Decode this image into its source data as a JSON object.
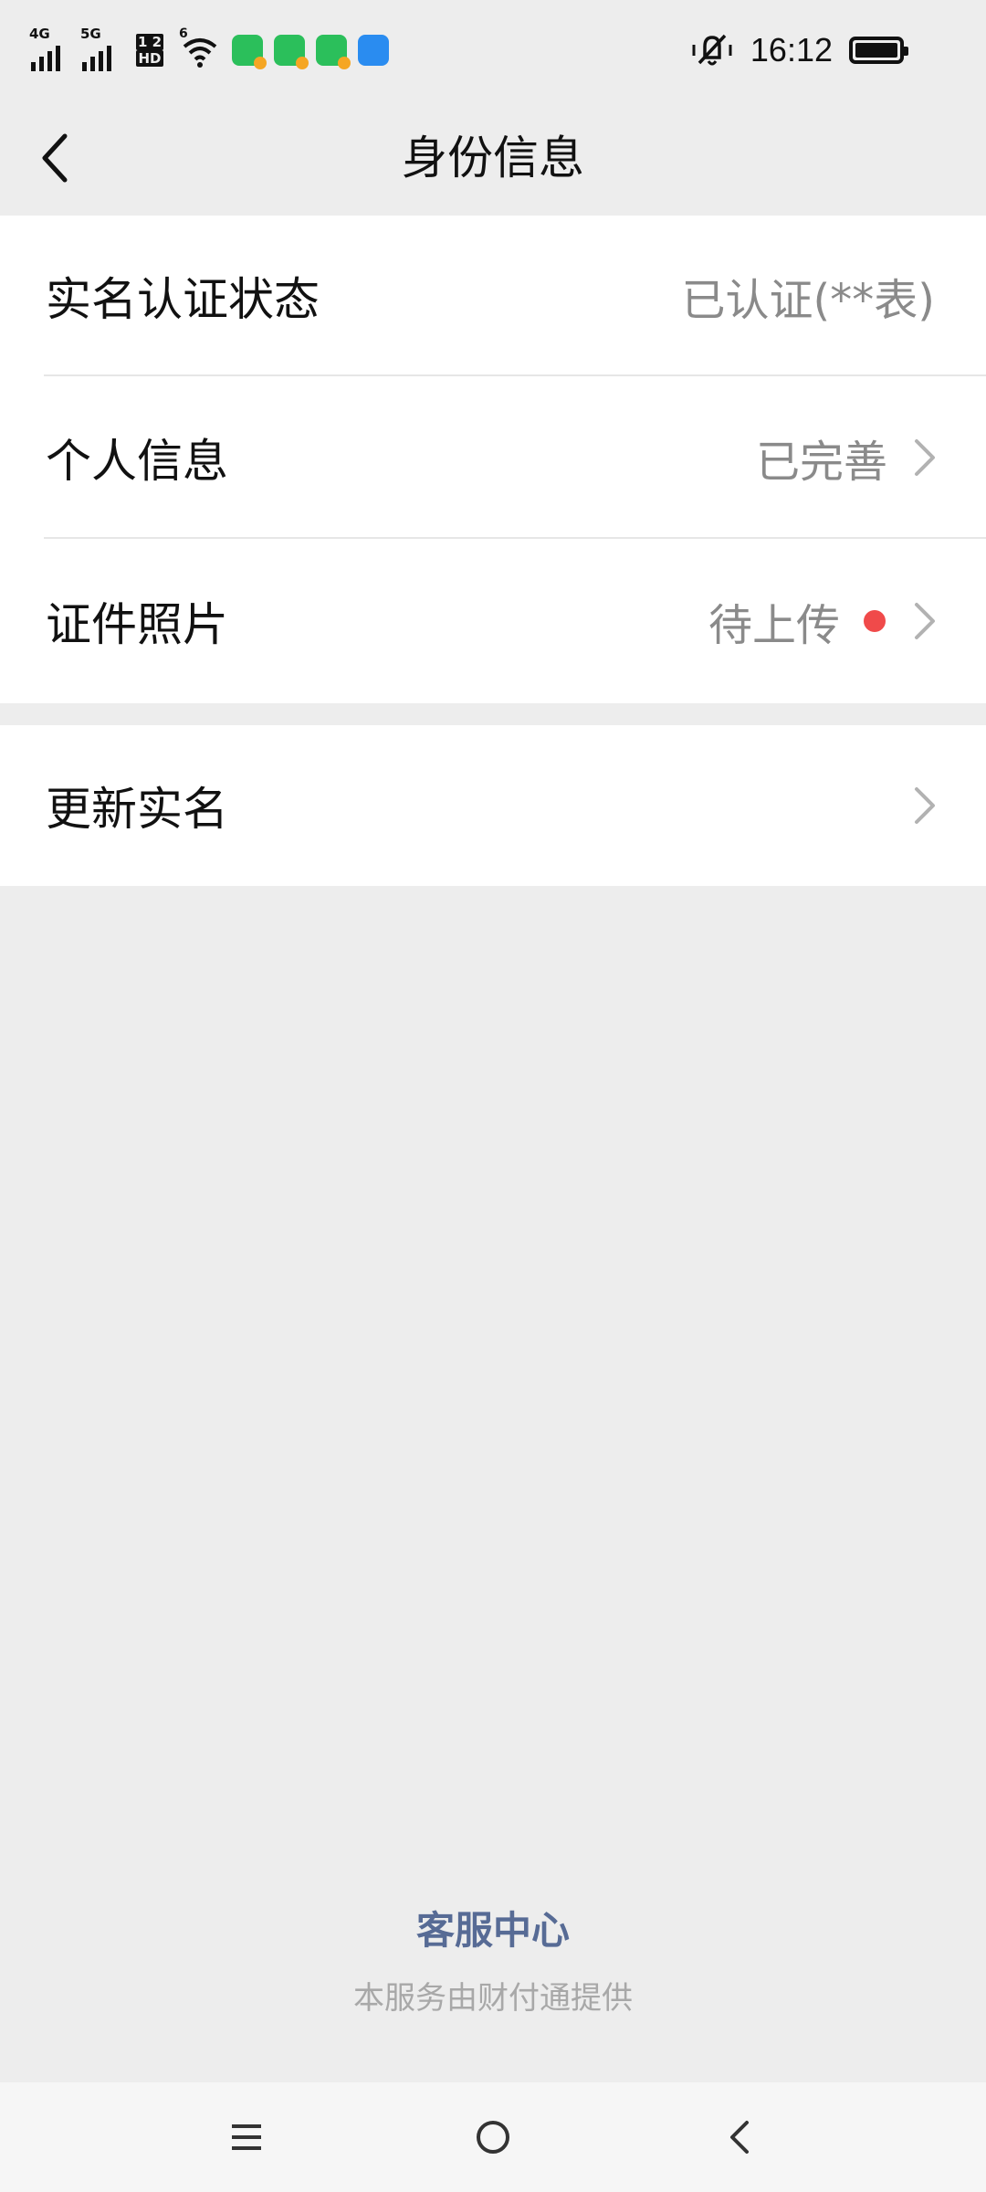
{
  "status_bar": {
    "signal1_label": "4G",
    "signal2_label": "5G",
    "hd_top": "1 2",
    "hd_bottom": "HD",
    "wifi_label": "6",
    "time": "16:12",
    "icons": [
      "signal-4g-icon",
      "signal-5g-icon",
      "hd-icon",
      "wifi-icon",
      "wechat-icon",
      "wechat-icon",
      "wechat-icon",
      "browser-icon",
      "mute-vibrate-icon",
      "battery-icon"
    ]
  },
  "nav": {
    "title": "身份信息",
    "back_icon": "chevron-left-icon"
  },
  "group1": [
    {
      "label": "实名认证状态",
      "value": "已认证(**表)",
      "arrow": false,
      "dot": false
    },
    {
      "label": "个人信息",
      "value": "已完善",
      "arrow": true,
      "dot": false
    },
    {
      "label": "证件照片",
      "value": "待上传",
      "arrow": true,
      "dot": true
    }
  ],
  "group2": [
    {
      "label": "更新实名",
      "value": "",
      "arrow": true,
      "dot": false
    }
  ],
  "footer": {
    "link": "客服中心",
    "note": "本服务由财付通提供"
  },
  "colors": {
    "background": "#ededed",
    "cell": "#ffffff",
    "link": "#576b95",
    "dot": "#f04a4a",
    "value": "#8a8a8a"
  }
}
